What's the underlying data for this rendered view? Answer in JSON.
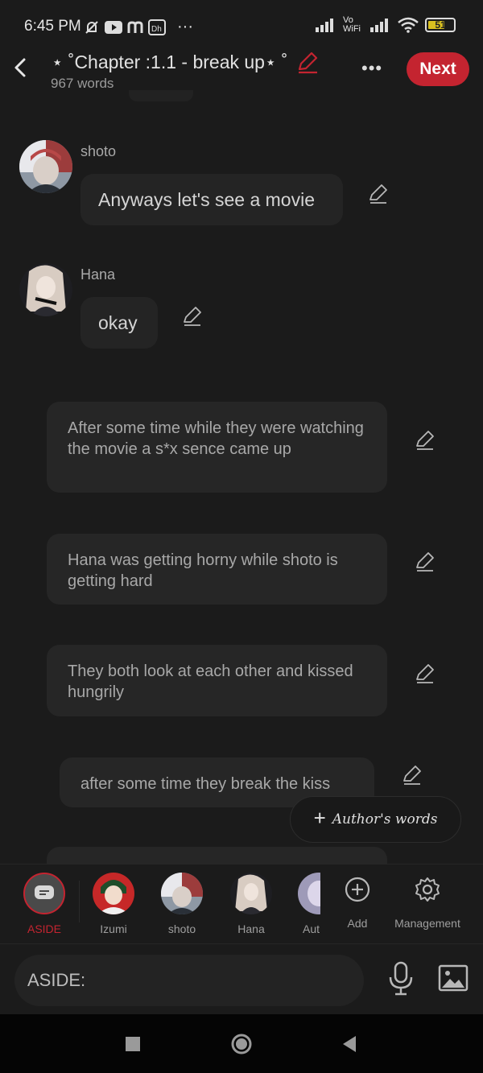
{
  "status_bar": {
    "time": "6:45 PM",
    "network_label": "Vo WiFi",
    "battery": "51"
  },
  "header": {
    "title": "⋆ ˚Chapter :1.1 - break up⋆ ˚",
    "word_count": "967 words",
    "more_label": "•••",
    "next_label": "Next"
  },
  "messages": [
    {
      "speaker": "shoto",
      "text": "Anyways let's see a movie"
    },
    {
      "speaker": "Hana",
      "text": "okay"
    }
  ],
  "narration": [
    "After some time while they were watching the movie a s*x sence came up",
    "Hana was getting horny while shoto is getting hard",
    "They both look at each other and kissed hungrily",
    "after some time they break the kiss"
  ],
  "author_words_label": "Author's words",
  "characters": [
    {
      "label": "ASIDE",
      "active": true
    },
    {
      "label": "Izumi"
    },
    {
      "label": "shoto"
    },
    {
      "label": "Hana"
    },
    {
      "label": "Aut"
    }
  ],
  "actions": {
    "add_label": "Add",
    "management_label": "Management"
  },
  "input": {
    "prefix": "ASIDE:"
  },
  "colors": {
    "accent": "#c42430",
    "background": "#1b1b1b",
    "bubble": "#242424"
  }
}
